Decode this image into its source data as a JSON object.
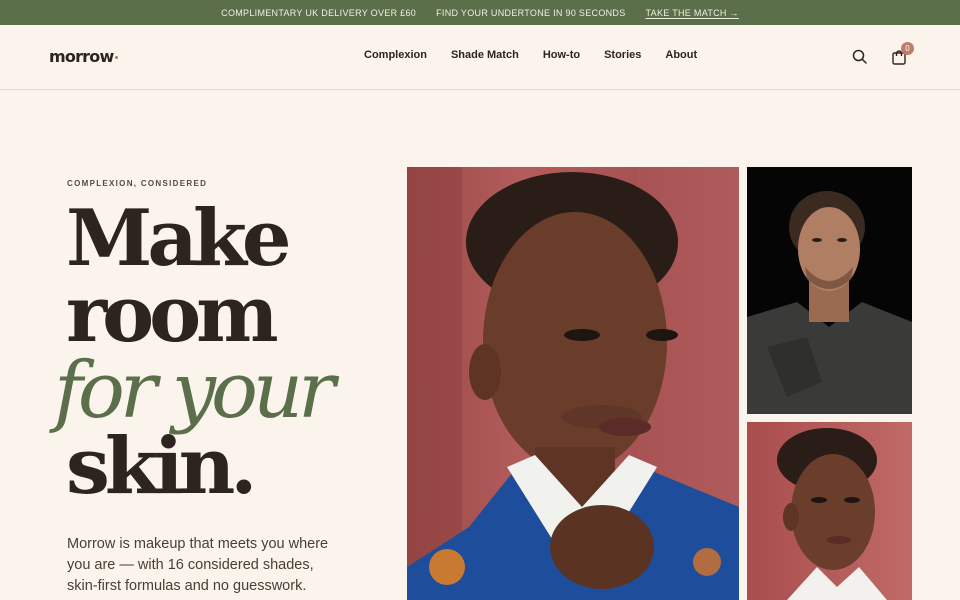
{
  "promo": {
    "delivery": "COMPLIMENTARY UK DELIVERY OVER £60",
    "undertone": "FIND YOUR UNDERTONE IN 90 SECONDS",
    "cta": "TAKE THE MATCH →"
  },
  "header": {
    "logo": "morrow",
    "nav": [
      "Complexion",
      "Shade Match",
      "How-to",
      "Stories",
      "About"
    ],
    "cart_count": "0",
    "icons": {
      "search": "search-icon",
      "cart": "shopping-bag-icon"
    }
  },
  "hero": {
    "eyebrow": "COMPLEXION, CONSIDERED",
    "headline": [
      "Make",
      "room",
      "for your",
      "skin."
    ],
    "intro": "Morrow is makeup that meets you where you are — with 16 considered shades, skin-first formulas and no guesswork."
  },
  "colors": {
    "promo_bg": "#5b6f4a",
    "accent_green": "#5b6f4a",
    "background": "#fbf4ec",
    "text": "#2e241f",
    "badge": "#bf7c69"
  }
}
